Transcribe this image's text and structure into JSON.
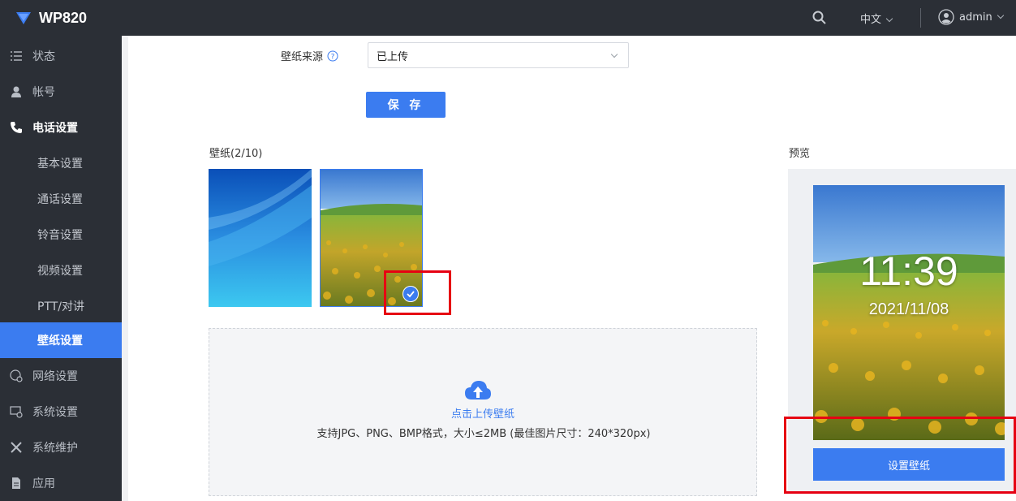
{
  "app": {
    "title": "WP820"
  },
  "topbar": {
    "search_icon": "search-icon",
    "language": "中文",
    "user": "admin"
  },
  "sidebar": {
    "items": [
      {
        "label": "状态",
        "icon": "list-icon"
      },
      {
        "label": "帐号",
        "icon": "user-icon"
      },
      {
        "label": "电话设置",
        "icon": "phone-icon"
      },
      {
        "label": "基本设置"
      },
      {
        "label": "通话设置"
      },
      {
        "label": "铃音设置"
      },
      {
        "label": "视频设置"
      },
      {
        "label": "PTT/对讲"
      },
      {
        "label": "壁纸设置"
      },
      {
        "label": "网络设置",
        "icon": "network-icon"
      },
      {
        "label": "系统设置",
        "icon": "system-settings-icon"
      },
      {
        "label": "系统维护",
        "icon": "tools-icon"
      },
      {
        "label": "应用",
        "icon": "document-icon"
      }
    ],
    "active": "壁纸设置"
  },
  "form": {
    "source_label": "壁纸来源",
    "source_value": "已上传",
    "save_label": "保 存"
  },
  "wallpapers": {
    "title": "壁纸(2/10)",
    "selected_index": 1
  },
  "upload": {
    "link": "点击上传壁纸",
    "hint": "支持JPG、PNG、BMP格式，大小≤2MB (最佳图片尺寸：240*320px)"
  },
  "preview": {
    "title": "预览",
    "time": "11:39",
    "date": "2021/11/08",
    "set_button": "设置壁纸"
  },
  "colors": {
    "accent": "#3b7cf0",
    "sidebar_bg": "#2b2f36",
    "highlight_box": "#e60012"
  }
}
